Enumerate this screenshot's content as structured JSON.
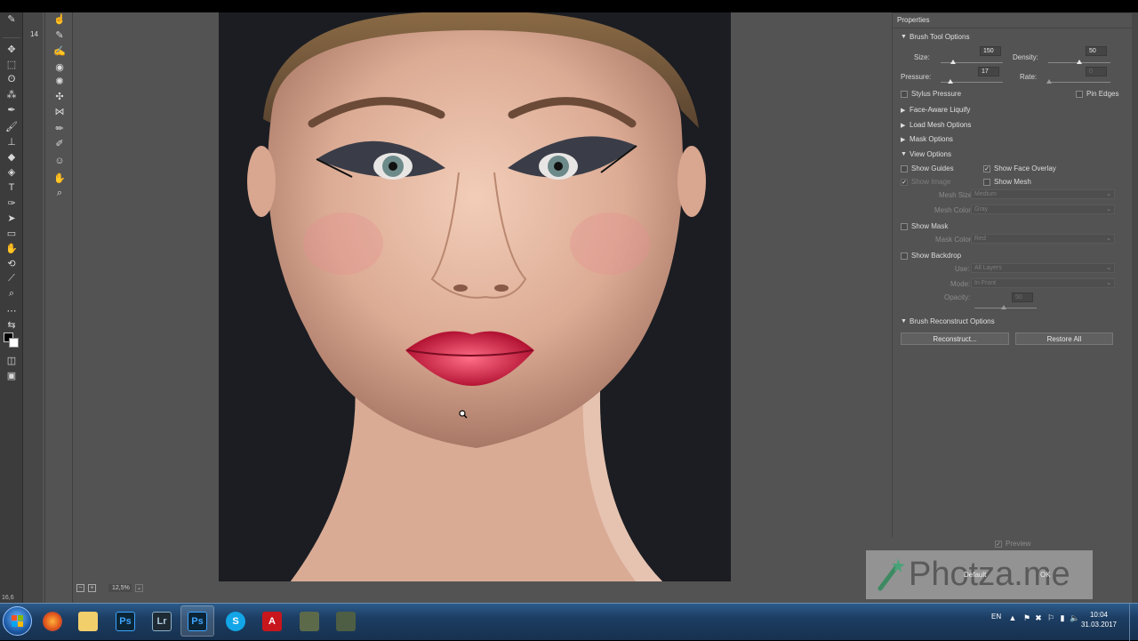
{
  "app": {
    "ps_tool_number": "14",
    "ps_zoom_label": "16,6"
  },
  "status": {
    "zoom": "12,5%"
  },
  "properties": {
    "title": "Properties",
    "brush_tool_options": {
      "header": "Brush Tool Options",
      "size_label": "Size:",
      "size_value": "150",
      "density_label": "Density:",
      "density_value": "50",
      "pressure_label": "Pressure:",
      "pressure_value": "17",
      "rate_label": "Rate:",
      "rate_value": "0",
      "stylus_pressure": "Stylus Pressure",
      "pin_edges": "Pin Edges"
    },
    "face_aware_liquify": "Face-Aware Liquify",
    "load_mesh_options": "Load Mesh Options",
    "mask_options": "Mask Options",
    "view_options": {
      "header": "View Options",
      "show_guides": "Show Guides",
      "show_face_overlay": "Show Face Overlay",
      "show_image": "Show Image",
      "show_mesh": "Show Mesh",
      "mesh_size_label": "Mesh Size:",
      "mesh_size_value": "Medium",
      "mesh_color_label": "Mesh Color:",
      "mesh_color_value": "Gray",
      "show_mask": "Show Mask",
      "mask_color_label": "Mask Color:",
      "mask_color_value": "Red",
      "show_backdrop": "Show Backdrop",
      "use_label": "Use:",
      "use_value": "All Layers",
      "mode_label": "Mode:",
      "mode_value": "In Front",
      "opacity_label": "Opacity:",
      "opacity_value": "50"
    },
    "brush_reconstruct": {
      "header": "Brush Reconstruct Options",
      "reconstruct": "Reconstruct...",
      "restore_all": "Restore All"
    },
    "preview": "Preview"
  },
  "watermark": {
    "text": "Photza.me",
    "ghost_default": "Default",
    "ghost_ok": "OK"
  },
  "taskbar": {
    "apps": [
      {
        "name": "Firefox",
        "icon": "firefox-icon"
      },
      {
        "name": "Explorer",
        "icon": "folder-icon"
      },
      {
        "name": "Ps",
        "icon": "photoshop-icon"
      },
      {
        "name": "Lr",
        "icon": "lightroom-icon"
      },
      {
        "name": "Ps",
        "icon": "photoshop-icon"
      },
      {
        "name": "S",
        "icon": "skype-icon"
      },
      {
        "name": "Acrobat",
        "icon": "acrobat-icon"
      },
      {
        "name": "App",
        "icon": "app-icon"
      },
      {
        "name": "App",
        "icon": "app-icon"
      }
    ],
    "lang": "EN",
    "time": "10:04",
    "date": "31.03.2017"
  },
  "colors": {
    "panel_bg": "#535353",
    "canvas_bg": "#1b1d22",
    "taskbar": "#1c3d62"
  }
}
